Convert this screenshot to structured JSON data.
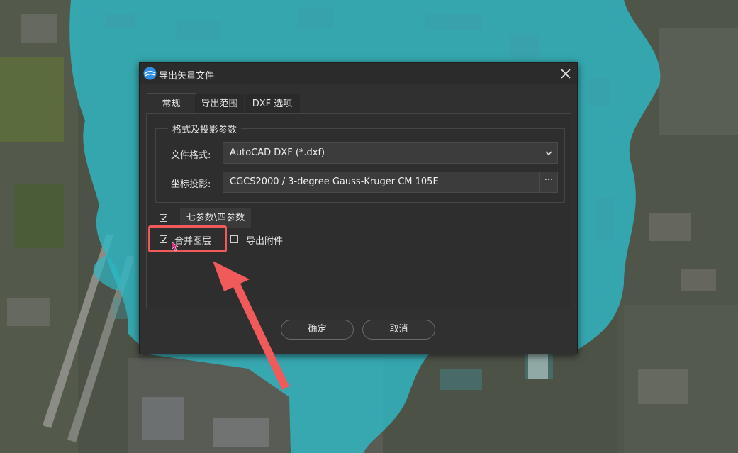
{
  "window": {
    "title": "导出矢量文件"
  },
  "tabs": [
    {
      "label": "常规",
      "active": true
    },
    {
      "label": "导出范围",
      "active": false
    },
    {
      "label": "DXF 选项",
      "active": false
    }
  ],
  "group": {
    "title": "格式及投影参数",
    "format_label": "文件格式:",
    "format_value": "AutoCAD DXF (*.dxf)",
    "projection_label": "坐标投影:",
    "projection_value": "CGCS2000 / 3-degree Gauss-Kruger CM 105E",
    "projection_button": "···"
  },
  "options": {
    "seven_param_checked": true,
    "seven_param_button": "七参数\\四参数",
    "merge_layers_label": "合并图层",
    "merge_layers_checked": true,
    "export_attachments_label": "导出附件",
    "export_attachments_checked": false
  },
  "buttons": {
    "ok": "确定",
    "cancel": "取消"
  },
  "colors": {
    "highlight": "#f05a5a",
    "water_overlay": "#2fb8c4",
    "dialog_bg": "#303030"
  },
  "icons": [
    "app-logo-icon",
    "close-icon",
    "chevron-down-icon",
    "checkmark-icon",
    "annotation-arrow",
    "mouse-cursor-icon"
  ]
}
